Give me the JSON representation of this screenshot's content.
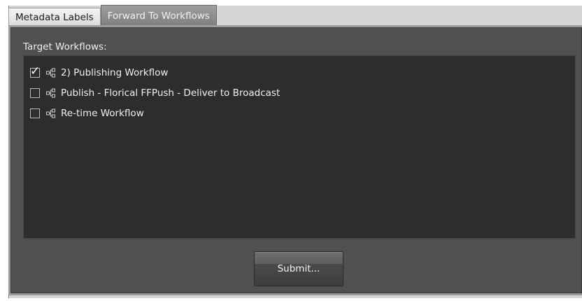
{
  "tabs": [
    {
      "label": "Metadata Labels",
      "active": false
    },
    {
      "label": "Forward To Workflows",
      "active": true
    }
  ],
  "target": {
    "label": "Target Workflows:",
    "items": [
      {
        "label": "2) Publishing Workflow",
        "checked": true,
        "icon": "workflow-icon"
      },
      {
        "label": "Publish - Florical FFPush - Deliver to Broadcast",
        "checked": false,
        "icon": "workflow-icon"
      },
      {
        "label": "Re-time Workflow",
        "checked": false,
        "icon": "workflow-icon"
      }
    ]
  },
  "submit_label": "Submit...",
  "check_glyph": "✓"
}
